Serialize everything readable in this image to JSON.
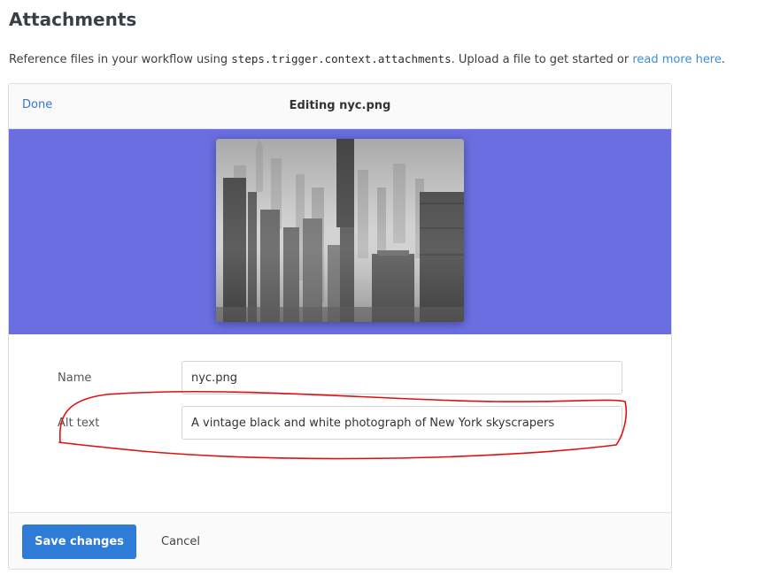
{
  "page": {
    "title": "Attachments",
    "intro_prefix": "Reference files in your workflow using ",
    "intro_code": "steps.trigger.context.attachments",
    "intro_middle": ". Upload a file to get started or ",
    "intro_link": "read more here",
    "intro_suffix": "."
  },
  "editor": {
    "done_label": "Done",
    "title": "Editing nyc.png"
  },
  "form": {
    "name_label": "Name",
    "name_value": "nyc.png",
    "alt_label": "Alt text",
    "alt_value": "A vintage black and white photograph of New York skyscrapers"
  },
  "footer": {
    "save_label": "Save changes",
    "cancel_label": "Cancel"
  },
  "colors": {
    "preview_bg": "#6a6ee0",
    "primary_button": "#2f7bd8",
    "link": "#3b8fd6",
    "annotation": "#e01010"
  }
}
